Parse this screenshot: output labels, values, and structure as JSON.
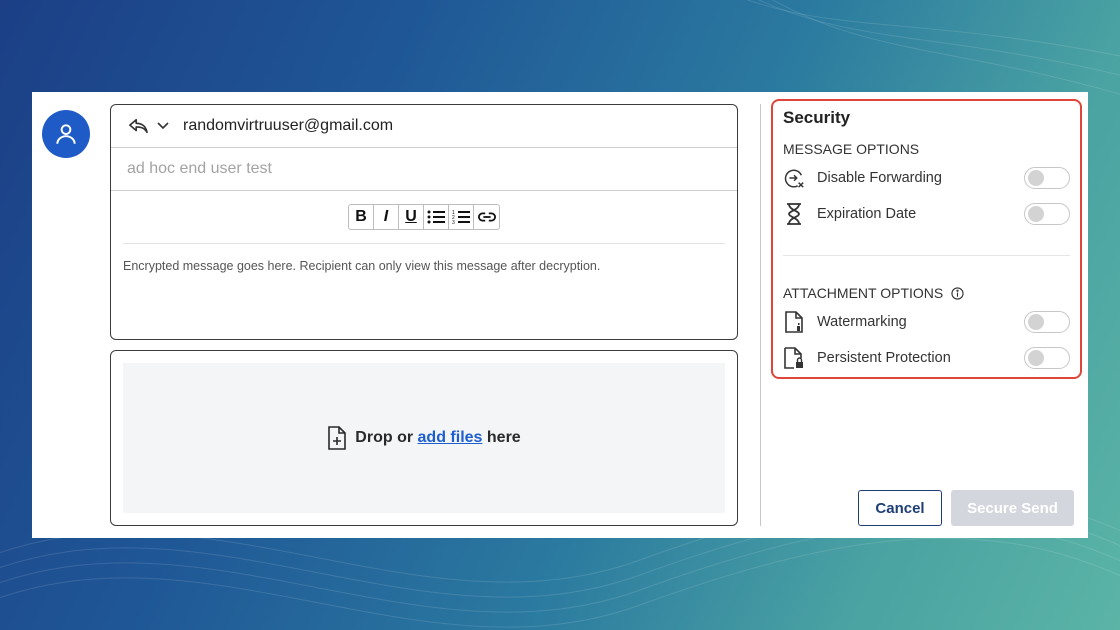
{
  "compose": {
    "to_email": "randomvirtruuser@gmail.com",
    "subject_placeholder": "ad hoc end user test",
    "toolbar": [
      "B",
      "I",
      "U"
    ],
    "body_text": "Encrypted message goes here. Recipient can only view this message after decryption."
  },
  "attachments": {
    "drop_prefix": "Drop or",
    "add_files_link": "add files",
    "drop_suffix": "here"
  },
  "security": {
    "title": "Security",
    "message_options_heading": "MESSAGE OPTIONS",
    "message_options": [
      {
        "label": "Disable Forwarding",
        "icon": "disable-forwarding-icon",
        "enabled": false
      },
      {
        "label": "Expiration Date",
        "icon": "hourglass-icon",
        "enabled": false
      }
    ],
    "attachment_options_heading": "ATTACHMENT OPTIONS",
    "attachment_options": [
      {
        "label": "Watermarking",
        "icon": "watermark-file-icon",
        "enabled": false
      },
      {
        "label": "Persistent Protection",
        "icon": "locked-file-icon",
        "enabled": false
      }
    ]
  },
  "actions": {
    "cancel_label": "Cancel",
    "send_label": "Secure Send"
  },
  "colors": {
    "accent_blue": "#1e5bc6",
    "link_blue": "#1d5fd0",
    "highlight_red": "#e0453a",
    "disabled_gray": "#d3d6dc"
  }
}
